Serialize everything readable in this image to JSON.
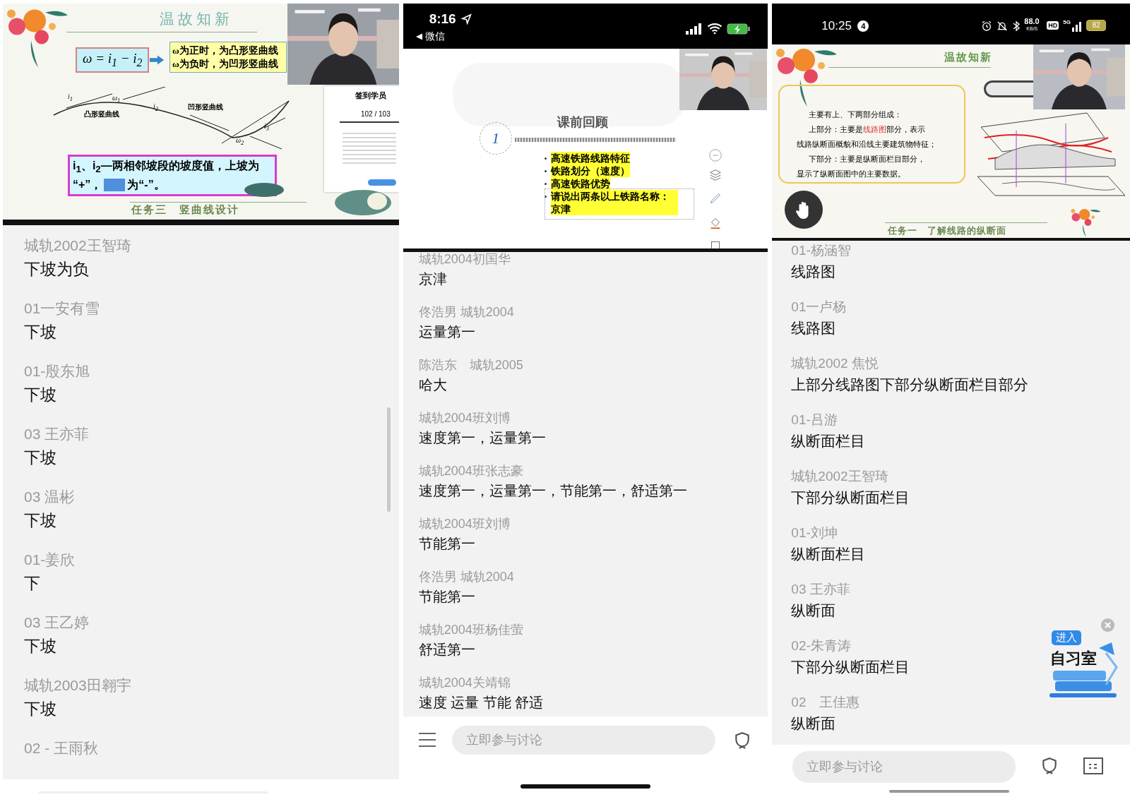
{
  "panels": [
    {
      "slide": {
        "kind": "vertical-curve",
        "title": "温故知新",
        "formula": "*ω* = *i*$_{1}$ − *i*$_{2}$",
        "rules": [
          "ω为正时，为凸形竖曲线",
          "ω为负时，为凹形竖曲线"
        ],
        "curve_labels": [
          "凸形竖曲线",
          "凹形竖曲线"
        ],
        "curve_symbols": [
          "i$_{1}$",
          "ω$_{1}$",
          "i$_{2}$",
          "i$_{3}$",
          "ω$_{2}$"
        ],
        "note": "i$_{1}$、i$_{2}$—两相邻坡段的坡度值，上坡为",
        "note_mid": "“+”，",
        "note_end": "为“-”。",
        "footer": "任务三　竖曲线设计",
        "side_panel": {
          "title": "签到学员",
          "count": "102 / 103"
        }
      },
      "scrollbar": true,
      "messages": [
        {
          "name": "城轨2002王智琦",
          "text": "下坡为负"
        },
        {
          "name": "01一安有雪",
          "text": "下坡"
        },
        {
          "name": "01-殷东旭",
          "text": "下坡"
        },
        {
          "name": "03 王亦菲",
          "text": "下坡"
        },
        {
          "name": "03 温彬",
          "text": "下坡"
        },
        {
          "name": "01-姜欣",
          "text": "下"
        },
        {
          "name": "03 王乙婷",
          "text": "下坡"
        },
        {
          "name": "城轨2003田翱宇",
          "text": "下坡"
        },
        {
          "name": "02 - 王雨秋"
        }
      ]
    },
    {
      "status_bar": {
        "kind": "ios",
        "time": "8:16",
        "back": "微信"
      },
      "slide": {
        "kind": "review",
        "title": "课前回顾",
        "number": "1",
        "bullets": [
          "高速铁路线路特征",
          "铁路划分（速度）",
          "高速铁路优势",
          "请说出两条以上铁路名称：京津"
        ]
      },
      "messages": [
        {
          "name": "城轨2004初国华",
          "text": "京津"
        },
        {
          "name": "佟浩男 城轨2004",
          "text": "运量第一"
        },
        {
          "name": "陈浩东　城轨2005",
          "text": "哈大"
        },
        {
          "name": "城轨2004班刘博",
          "text": "速度第一，运量第一"
        },
        {
          "name": "城轨2004班张志豪",
          "text": "速度第一，运量第一，节能第一，舒适第一"
        },
        {
          "name": "城轨2004班刘博",
          "text": "节能第一"
        },
        {
          "name": "佟浩男 城轨2004",
          "text": "节能第一"
        },
        {
          "name": "城轨2004班杨佳萤",
          "text": "舒适第一"
        },
        {
          "name": "城轨2004关靖锦",
          "text": "速度 运量 节能 舒适"
        }
      ],
      "composer": {
        "kind": "ios",
        "placeholder": "立即参与讨论"
      }
    },
    {
      "status_bar": {
        "kind": "android",
        "time": "10:25",
        "badge": "4",
        "speed": "88.0",
        "speed_unit": "KB/S",
        "hd": "HD",
        "network": "5G",
        "battery": "82"
      },
      "slide": {
        "kind": "profile",
        "title": "温故知新",
        "lines": [
          {
            "indent": true,
            "segments": [
              {
                "text": "主要有上、下两部分组成：",
                "emphasis": false
              }
            ]
          },
          {
            "indent": true,
            "segments": [
              {
                "text": "上部分：主要是",
                "emphasis": false
              },
              {
                "text": "线路图",
                "emphasis": true
              },
              {
                "text": "部分，表示",
                "emphasis": false
              }
            ]
          },
          {
            "indent": false,
            "segments": [
              {
                "text": "线路纵断面概貌和沿线主要建筑物特征；",
                "emphasis": false
              }
            ]
          },
          {
            "indent": true,
            "segments": [
              {
                "text": "下部分：主要是纵断面栏目部分，",
                "emphasis": false
              }
            ]
          },
          {
            "indent": false,
            "segments": [
              {
                "text": "显示了纵断面图中的主要数据。",
                "emphasis": false
              }
            ]
          }
        ],
        "footer": "任务一　了解线路的纵断面"
      },
      "messages": [
        {
          "name": "01-杨涵智",
          "text": "线路图"
        },
        {
          "name": "01一卢杨",
          "text": "线路图"
        },
        {
          "name": "城轨2002 焦悦",
          "text": "上部分线路图下部分纵断面栏目部分"
        },
        {
          "name": "01-吕游",
          "text": "纵断面栏目"
        },
        {
          "name": "城轨2002王智琦",
          "text": "下部分纵断面栏目"
        },
        {
          "name": "01-刘坤",
          "text": "纵断面栏目"
        },
        {
          "name": "03 王亦菲",
          "text": "纵断面"
        },
        {
          "name": "02-朱青涛",
          "text": "下部分纵断面栏目"
        },
        {
          "name": "02　王佳惠",
          "text": "纵断面"
        }
      ],
      "widget": {
        "tag": "进入",
        "label": "自习室"
      },
      "composer": {
        "kind": "android",
        "placeholder": "立即参与讨论"
      }
    }
  ]
}
